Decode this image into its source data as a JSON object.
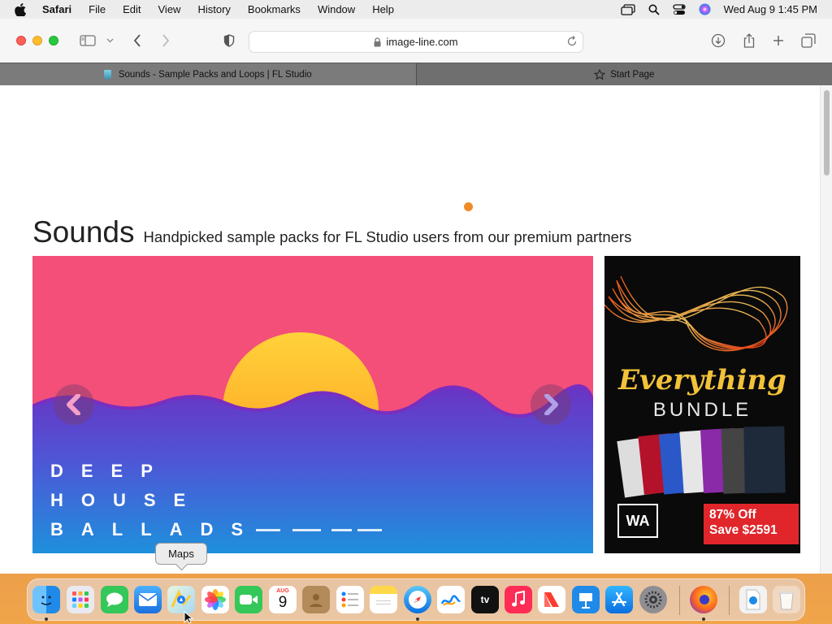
{
  "menubar": {
    "app": "Safari",
    "items": [
      "File",
      "Edit",
      "View",
      "History",
      "Bookmarks",
      "Window",
      "Help"
    ],
    "clock": "Wed Aug 9  1:45 PM"
  },
  "toolbar": {
    "url": "image-line.com"
  },
  "tabs": [
    {
      "label": "Sounds - Sample Packs and Loops | FL Studio"
    },
    {
      "label": "Start Page"
    }
  ],
  "page": {
    "heading": "Sounds",
    "subheading": "Handpicked sample packs for FL Studio users from our premium partners",
    "slide": {
      "lines": [
        "DEEP",
        "HOUSE",
        "BALLADS"
      ],
      "colors": {
        "sky": "#f34f78",
        "sun": "#ffb62a",
        "sea": "#4d57d6"
      }
    },
    "ad": {
      "title": "Everything",
      "subtitle": "BUNDLE",
      "logo": "WA",
      "deal_line1": "87% Off",
      "deal_line2": "Save $2591"
    }
  },
  "tooltip": "Maps",
  "dock": {
    "calendar_month": "AUG",
    "calendar_day": "9",
    "tv_label": "tv"
  }
}
